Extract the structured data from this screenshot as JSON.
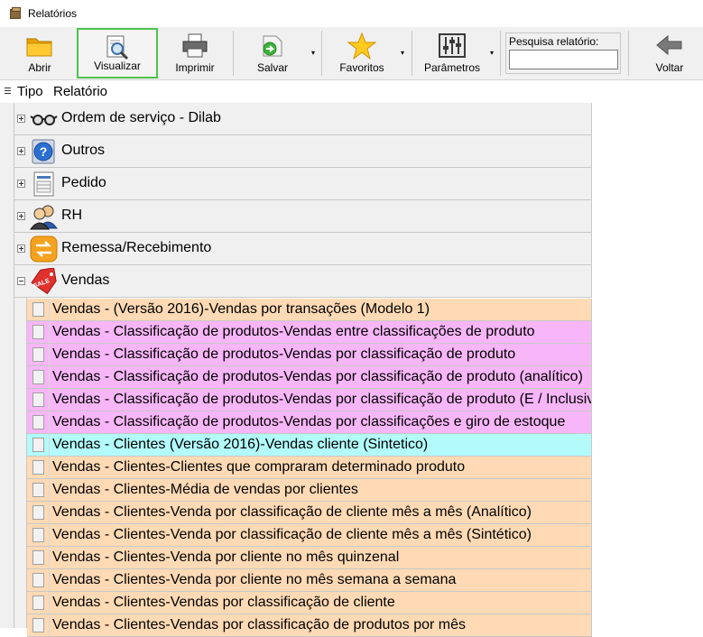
{
  "window": {
    "title": "Relatórios"
  },
  "toolbar": {
    "buttons": [
      {
        "label": "Abrir",
        "icon": "folder-icon"
      },
      {
        "label": "Visualizar",
        "icon": "magnifier-document-icon"
      },
      {
        "label": "Imprimir",
        "icon": "printer-icon"
      },
      {
        "label": "Salvar",
        "icon": "save-arrow-icon"
      },
      {
        "label": "Favoritos",
        "icon": "star-icon"
      },
      {
        "label": "Parâmetros",
        "icon": "sliders-icon"
      },
      {
        "label": "Voltar",
        "icon": "back-arrow-icon"
      }
    ],
    "search": {
      "label": "Pesquisa relatório:",
      "value": "",
      "placeholder": ""
    }
  },
  "grid": {
    "columns": [
      "Tipo",
      "Relatório"
    ],
    "groups": [
      {
        "label": "Ordem de serviço - Dilab",
        "icon": "glasses-icon",
        "expanded": false
      },
      {
        "label": "Outros",
        "icon": "help-icon",
        "expanded": false
      },
      {
        "label": "Pedido",
        "icon": "form-document-icon",
        "expanded": false
      },
      {
        "label": "RH",
        "icon": "people-icon",
        "expanded": false
      },
      {
        "label": "Remessa/Recebimento",
        "icon": "exchange-icon",
        "expanded": false
      },
      {
        "label": "Vendas",
        "icon": "sale-tag-icon",
        "expanded": true
      }
    ],
    "items": [
      {
        "label": "Vendas - (Versão 2016)-Vendas por transações (Modelo 1)",
        "color": "#ffdab5"
      },
      {
        "label": "Vendas - Classificação de produtos-Vendas entre classificações de produto",
        "color": "#f7b6f7"
      },
      {
        "label": "Vendas - Classificação de produtos-Vendas por classificação de produto",
        "color": "#f7b6f7"
      },
      {
        "label": "Vendas - Classificação de produtos-Vendas por classificação de produto (analítico)",
        "color": "#f7b6f7"
      },
      {
        "label": "Vendas - Classificação de produtos-Vendas por classificação de produto (E / Inclusiv",
        "color": "#f7b6f7"
      },
      {
        "label": "Vendas - Classificação de produtos-Vendas por classificações e giro de estoque",
        "color": "#f7b6f7"
      },
      {
        "label": "Vendas - Clientes (Versão 2016)-Vendas cliente (Sintetico)",
        "color": "#b3fbfb"
      },
      {
        "label": "Vendas - Clientes-Clientes que compraram determinado produto",
        "color": "#ffdab5"
      },
      {
        "label": "Vendas - Clientes-Média de vendas por clientes",
        "color": "#ffdab5"
      },
      {
        "label": "Vendas - Clientes-Venda por classificação de cliente mês a mês (Analítico)",
        "color": "#ffdab5"
      },
      {
        "label": "Vendas - Clientes-Venda por classificação de cliente mês a mês (Sintético)",
        "color": "#ffdab5"
      },
      {
        "label": "Vendas - Clientes-Venda por cliente no mês quinzenal",
        "color": "#ffdab5"
      },
      {
        "label": "Vendas - Clientes-Venda por cliente no mês semana a semana",
        "color": "#ffdab5"
      },
      {
        "label": "Vendas - Clientes-Vendas por classificação de cliente",
        "color": "#ffdab5"
      },
      {
        "label": "Vendas - Clientes-Vendas por classificação de produtos por mês",
        "color": "#ffdab5"
      }
    ]
  }
}
